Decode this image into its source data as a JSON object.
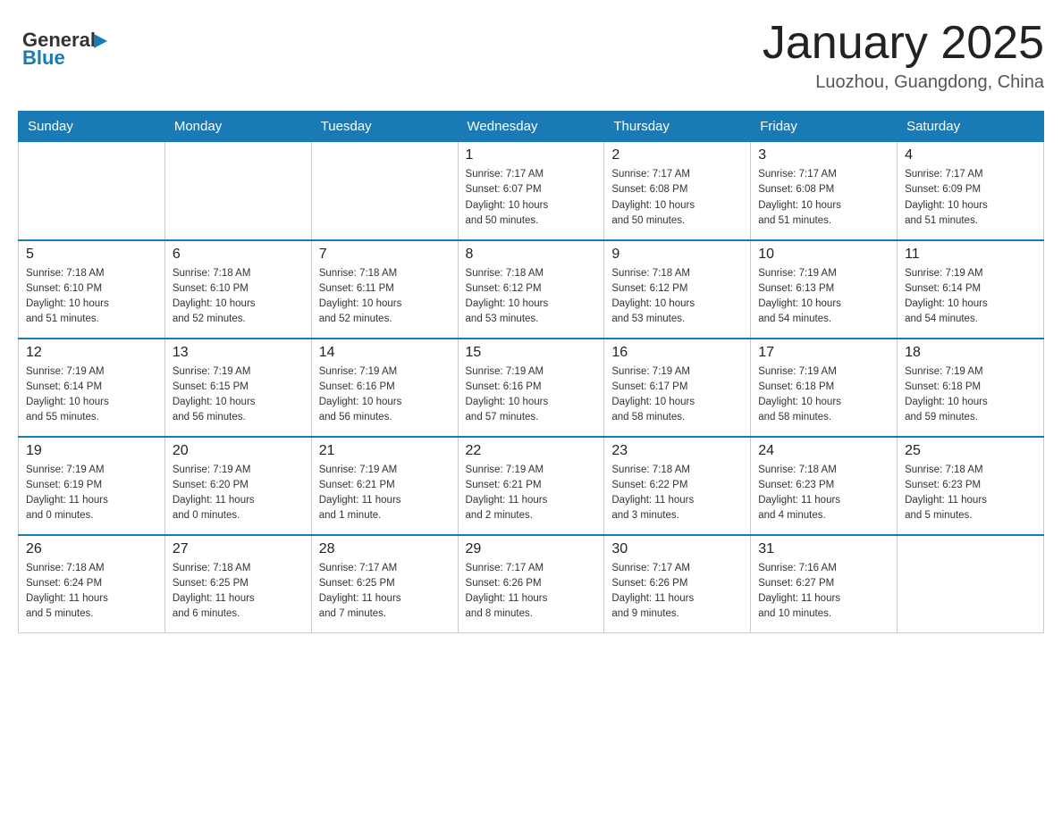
{
  "logo": {
    "text_general": "General",
    "text_blue": "Blue"
  },
  "title": "January 2025",
  "subtitle": "Luozhou, Guangdong, China",
  "days_of_week": [
    "Sunday",
    "Monday",
    "Tuesday",
    "Wednesday",
    "Thursday",
    "Friday",
    "Saturday"
  ],
  "weeks": [
    [
      {
        "day": "",
        "info": ""
      },
      {
        "day": "",
        "info": ""
      },
      {
        "day": "",
        "info": ""
      },
      {
        "day": "1",
        "info": "Sunrise: 7:17 AM\nSunset: 6:07 PM\nDaylight: 10 hours\nand 50 minutes."
      },
      {
        "day": "2",
        "info": "Sunrise: 7:17 AM\nSunset: 6:08 PM\nDaylight: 10 hours\nand 50 minutes."
      },
      {
        "day": "3",
        "info": "Sunrise: 7:17 AM\nSunset: 6:08 PM\nDaylight: 10 hours\nand 51 minutes."
      },
      {
        "day": "4",
        "info": "Sunrise: 7:17 AM\nSunset: 6:09 PM\nDaylight: 10 hours\nand 51 minutes."
      }
    ],
    [
      {
        "day": "5",
        "info": "Sunrise: 7:18 AM\nSunset: 6:10 PM\nDaylight: 10 hours\nand 51 minutes."
      },
      {
        "day": "6",
        "info": "Sunrise: 7:18 AM\nSunset: 6:10 PM\nDaylight: 10 hours\nand 52 minutes."
      },
      {
        "day": "7",
        "info": "Sunrise: 7:18 AM\nSunset: 6:11 PM\nDaylight: 10 hours\nand 52 minutes."
      },
      {
        "day": "8",
        "info": "Sunrise: 7:18 AM\nSunset: 6:12 PM\nDaylight: 10 hours\nand 53 minutes."
      },
      {
        "day": "9",
        "info": "Sunrise: 7:18 AM\nSunset: 6:12 PM\nDaylight: 10 hours\nand 53 minutes."
      },
      {
        "day": "10",
        "info": "Sunrise: 7:19 AM\nSunset: 6:13 PM\nDaylight: 10 hours\nand 54 minutes."
      },
      {
        "day": "11",
        "info": "Sunrise: 7:19 AM\nSunset: 6:14 PM\nDaylight: 10 hours\nand 54 minutes."
      }
    ],
    [
      {
        "day": "12",
        "info": "Sunrise: 7:19 AM\nSunset: 6:14 PM\nDaylight: 10 hours\nand 55 minutes."
      },
      {
        "day": "13",
        "info": "Sunrise: 7:19 AM\nSunset: 6:15 PM\nDaylight: 10 hours\nand 56 minutes."
      },
      {
        "day": "14",
        "info": "Sunrise: 7:19 AM\nSunset: 6:16 PM\nDaylight: 10 hours\nand 56 minutes."
      },
      {
        "day": "15",
        "info": "Sunrise: 7:19 AM\nSunset: 6:16 PM\nDaylight: 10 hours\nand 57 minutes."
      },
      {
        "day": "16",
        "info": "Sunrise: 7:19 AM\nSunset: 6:17 PM\nDaylight: 10 hours\nand 58 minutes."
      },
      {
        "day": "17",
        "info": "Sunrise: 7:19 AM\nSunset: 6:18 PM\nDaylight: 10 hours\nand 58 minutes."
      },
      {
        "day": "18",
        "info": "Sunrise: 7:19 AM\nSunset: 6:18 PM\nDaylight: 10 hours\nand 59 minutes."
      }
    ],
    [
      {
        "day": "19",
        "info": "Sunrise: 7:19 AM\nSunset: 6:19 PM\nDaylight: 11 hours\nand 0 minutes."
      },
      {
        "day": "20",
        "info": "Sunrise: 7:19 AM\nSunset: 6:20 PM\nDaylight: 11 hours\nand 0 minutes."
      },
      {
        "day": "21",
        "info": "Sunrise: 7:19 AM\nSunset: 6:21 PM\nDaylight: 11 hours\nand 1 minute."
      },
      {
        "day": "22",
        "info": "Sunrise: 7:19 AM\nSunset: 6:21 PM\nDaylight: 11 hours\nand 2 minutes."
      },
      {
        "day": "23",
        "info": "Sunrise: 7:18 AM\nSunset: 6:22 PM\nDaylight: 11 hours\nand 3 minutes."
      },
      {
        "day": "24",
        "info": "Sunrise: 7:18 AM\nSunset: 6:23 PM\nDaylight: 11 hours\nand 4 minutes."
      },
      {
        "day": "25",
        "info": "Sunrise: 7:18 AM\nSunset: 6:23 PM\nDaylight: 11 hours\nand 5 minutes."
      }
    ],
    [
      {
        "day": "26",
        "info": "Sunrise: 7:18 AM\nSunset: 6:24 PM\nDaylight: 11 hours\nand 5 minutes."
      },
      {
        "day": "27",
        "info": "Sunrise: 7:18 AM\nSunset: 6:25 PM\nDaylight: 11 hours\nand 6 minutes."
      },
      {
        "day": "28",
        "info": "Sunrise: 7:17 AM\nSunset: 6:25 PM\nDaylight: 11 hours\nand 7 minutes."
      },
      {
        "day": "29",
        "info": "Sunrise: 7:17 AM\nSunset: 6:26 PM\nDaylight: 11 hours\nand 8 minutes."
      },
      {
        "day": "30",
        "info": "Sunrise: 7:17 AM\nSunset: 6:26 PM\nDaylight: 11 hours\nand 9 minutes."
      },
      {
        "day": "31",
        "info": "Sunrise: 7:16 AM\nSunset: 6:27 PM\nDaylight: 11 hours\nand 10 minutes."
      },
      {
        "day": "",
        "info": ""
      }
    ]
  ]
}
